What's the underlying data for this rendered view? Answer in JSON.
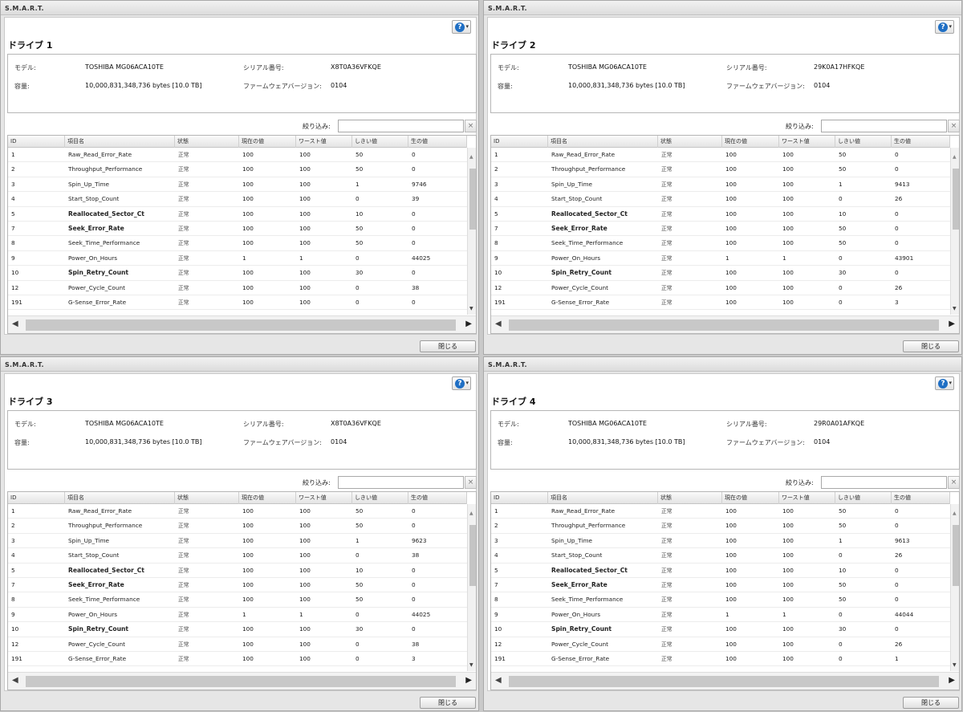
{
  "window_title": "S.M.A.R.T.",
  "labels": {
    "model": "モデル:",
    "serial": "シリアル番号:",
    "capacity": "容量:",
    "firmware": "ファームウェアバージョン:",
    "filter": "絞り込み:",
    "filter_clear": "×",
    "close": "閉じる",
    "help": "?"
  },
  "columns": [
    "ID",
    "項目名",
    "状態",
    "現在の値",
    "ワースト値",
    "しきい値",
    "生の値"
  ],
  "panels": [
    {
      "drive_title": "ドライブ 1",
      "model": "TOSHIBA MG06ACA10TE",
      "serial": "X8T0A36VFKQE",
      "capacity": "10,000,831,348,736 bytes [10.0 TB]",
      "firmware": "0104",
      "filter_value": "",
      "rows": [
        {
          "id": "1",
          "name": "Raw_Read_Error_Rate",
          "status": "正常",
          "current": "100",
          "worst": "100",
          "threshold": "50",
          "raw": "0",
          "bold": false
        },
        {
          "id": "2",
          "name": "Throughput_Performance",
          "status": "正常",
          "current": "100",
          "worst": "100",
          "threshold": "50",
          "raw": "0",
          "bold": false
        },
        {
          "id": "3",
          "name": "Spin_Up_Time",
          "status": "正常",
          "current": "100",
          "worst": "100",
          "threshold": "1",
          "raw": "9746",
          "bold": false
        },
        {
          "id": "4",
          "name": "Start_Stop_Count",
          "status": "正常",
          "current": "100",
          "worst": "100",
          "threshold": "0",
          "raw": "39",
          "bold": false
        },
        {
          "id": "5",
          "name": "Reallocated_Sector_Ct",
          "status": "正常",
          "current": "100",
          "worst": "100",
          "threshold": "10",
          "raw": "0",
          "bold": true
        },
        {
          "id": "7",
          "name": "Seek_Error_Rate",
          "status": "正常",
          "current": "100",
          "worst": "100",
          "threshold": "50",
          "raw": "0",
          "bold": true
        },
        {
          "id": "8",
          "name": "Seek_Time_Performance",
          "status": "正常",
          "current": "100",
          "worst": "100",
          "threshold": "50",
          "raw": "0",
          "bold": false
        },
        {
          "id": "9",
          "name": "Power_On_Hours",
          "status": "正常",
          "current": "1",
          "worst": "1",
          "threshold": "0",
          "raw": "44025",
          "bold": false
        },
        {
          "id": "10",
          "name": "Spin_Retry_Count",
          "status": "正常",
          "current": "100",
          "worst": "100",
          "threshold": "30",
          "raw": "0",
          "bold": true
        },
        {
          "id": "12",
          "name": "Power_Cycle_Count",
          "status": "正常",
          "current": "100",
          "worst": "100",
          "threshold": "0",
          "raw": "38",
          "bold": false
        },
        {
          "id": "191",
          "name": "G-Sense_Error_Rate",
          "status": "正常",
          "current": "100",
          "worst": "100",
          "threshold": "0",
          "raw": "0",
          "bold": false
        }
      ]
    },
    {
      "drive_title": "ドライブ 2",
      "model": "TOSHIBA MG06ACA10TE",
      "serial": "29K0A17HFKQE",
      "capacity": "10,000,831,348,736 bytes [10.0 TB]",
      "firmware": "0104",
      "filter_value": "",
      "rows": [
        {
          "id": "1",
          "name": "Raw_Read_Error_Rate",
          "status": "正常",
          "current": "100",
          "worst": "100",
          "threshold": "50",
          "raw": "0",
          "bold": false
        },
        {
          "id": "2",
          "name": "Throughput_Performance",
          "status": "正常",
          "current": "100",
          "worst": "100",
          "threshold": "50",
          "raw": "0",
          "bold": false
        },
        {
          "id": "3",
          "name": "Spin_Up_Time",
          "status": "正常",
          "current": "100",
          "worst": "100",
          "threshold": "1",
          "raw": "9413",
          "bold": false
        },
        {
          "id": "4",
          "name": "Start_Stop_Count",
          "status": "正常",
          "current": "100",
          "worst": "100",
          "threshold": "0",
          "raw": "26",
          "bold": false
        },
        {
          "id": "5",
          "name": "Reallocated_Sector_Ct",
          "status": "正常",
          "current": "100",
          "worst": "100",
          "threshold": "10",
          "raw": "0",
          "bold": true
        },
        {
          "id": "7",
          "name": "Seek_Error_Rate",
          "status": "正常",
          "current": "100",
          "worst": "100",
          "threshold": "50",
          "raw": "0",
          "bold": true
        },
        {
          "id": "8",
          "name": "Seek_Time_Performance",
          "status": "正常",
          "current": "100",
          "worst": "100",
          "threshold": "50",
          "raw": "0",
          "bold": false
        },
        {
          "id": "9",
          "name": "Power_On_Hours",
          "status": "正常",
          "current": "1",
          "worst": "1",
          "threshold": "0",
          "raw": "43901",
          "bold": false
        },
        {
          "id": "10",
          "name": "Spin_Retry_Count",
          "status": "正常",
          "current": "100",
          "worst": "100",
          "threshold": "30",
          "raw": "0",
          "bold": true
        },
        {
          "id": "12",
          "name": "Power_Cycle_Count",
          "status": "正常",
          "current": "100",
          "worst": "100",
          "threshold": "0",
          "raw": "26",
          "bold": false
        },
        {
          "id": "191",
          "name": "G-Sense_Error_Rate",
          "status": "正常",
          "current": "100",
          "worst": "100",
          "threshold": "0",
          "raw": "3",
          "bold": false
        }
      ]
    },
    {
      "drive_title": "ドライブ 3",
      "model": "TOSHIBA MG06ACA10TE",
      "serial": "X8T0A36VFKQE",
      "capacity": "10,000,831,348,736 bytes [10.0 TB]",
      "firmware": "0104",
      "filter_value": "",
      "rows": [
        {
          "id": "1",
          "name": "Raw_Read_Error_Rate",
          "status": "正常",
          "current": "100",
          "worst": "100",
          "threshold": "50",
          "raw": "0",
          "bold": false
        },
        {
          "id": "2",
          "name": "Throughput_Performance",
          "status": "正常",
          "current": "100",
          "worst": "100",
          "threshold": "50",
          "raw": "0",
          "bold": false
        },
        {
          "id": "3",
          "name": "Spin_Up_Time",
          "status": "正常",
          "current": "100",
          "worst": "100",
          "threshold": "1",
          "raw": "9623",
          "bold": false
        },
        {
          "id": "4",
          "name": "Start_Stop_Count",
          "status": "正常",
          "current": "100",
          "worst": "100",
          "threshold": "0",
          "raw": "38",
          "bold": false
        },
        {
          "id": "5",
          "name": "Reallocated_Sector_Ct",
          "status": "正常",
          "current": "100",
          "worst": "100",
          "threshold": "10",
          "raw": "0",
          "bold": true
        },
        {
          "id": "7",
          "name": "Seek_Error_Rate",
          "status": "正常",
          "current": "100",
          "worst": "100",
          "threshold": "50",
          "raw": "0",
          "bold": true
        },
        {
          "id": "8",
          "name": "Seek_Time_Performance",
          "status": "正常",
          "current": "100",
          "worst": "100",
          "threshold": "50",
          "raw": "0",
          "bold": false
        },
        {
          "id": "9",
          "name": "Power_On_Hours",
          "status": "正常",
          "current": "1",
          "worst": "1",
          "threshold": "0",
          "raw": "44025",
          "bold": false
        },
        {
          "id": "10",
          "name": "Spin_Retry_Count",
          "status": "正常",
          "current": "100",
          "worst": "100",
          "threshold": "30",
          "raw": "0",
          "bold": true
        },
        {
          "id": "12",
          "name": "Power_Cycle_Count",
          "status": "正常",
          "current": "100",
          "worst": "100",
          "threshold": "0",
          "raw": "38",
          "bold": false
        },
        {
          "id": "191",
          "name": "G-Sense_Error_Rate",
          "status": "正常",
          "current": "100",
          "worst": "100",
          "threshold": "0",
          "raw": "3",
          "bold": false
        }
      ]
    },
    {
      "drive_title": "ドライブ 4",
      "model": "TOSHIBA MG06ACA10TE",
      "serial": "29R0A01AFKQE",
      "capacity": "10,000,831,348,736 bytes [10.0 TB]",
      "firmware": "0104",
      "filter_value": "",
      "rows": [
        {
          "id": "1",
          "name": "Raw_Read_Error_Rate",
          "status": "正常",
          "current": "100",
          "worst": "100",
          "threshold": "50",
          "raw": "0",
          "bold": false
        },
        {
          "id": "2",
          "name": "Throughput_Performance",
          "status": "正常",
          "current": "100",
          "worst": "100",
          "threshold": "50",
          "raw": "0",
          "bold": false
        },
        {
          "id": "3",
          "name": "Spin_Up_Time",
          "status": "正常",
          "current": "100",
          "worst": "100",
          "threshold": "1",
          "raw": "9613",
          "bold": false
        },
        {
          "id": "4",
          "name": "Start_Stop_Count",
          "status": "正常",
          "current": "100",
          "worst": "100",
          "threshold": "0",
          "raw": "26",
          "bold": false
        },
        {
          "id": "5",
          "name": "Reallocated_Sector_Ct",
          "status": "正常",
          "current": "100",
          "worst": "100",
          "threshold": "10",
          "raw": "0",
          "bold": true
        },
        {
          "id": "7",
          "name": "Seek_Error_Rate",
          "status": "正常",
          "current": "100",
          "worst": "100",
          "threshold": "50",
          "raw": "0",
          "bold": true
        },
        {
          "id": "8",
          "name": "Seek_Time_Performance",
          "status": "正常",
          "current": "100",
          "worst": "100",
          "threshold": "50",
          "raw": "0",
          "bold": false
        },
        {
          "id": "9",
          "name": "Power_On_Hours",
          "status": "正常",
          "current": "1",
          "worst": "1",
          "threshold": "0",
          "raw": "44044",
          "bold": false
        },
        {
          "id": "10",
          "name": "Spin_Retry_Count",
          "status": "正常",
          "current": "100",
          "worst": "100",
          "threshold": "30",
          "raw": "0",
          "bold": true
        },
        {
          "id": "12",
          "name": "Power_Cycle_Count",
          "status": "正常",
          "current": "100",
          "worst": "100",
          "threshold": "0",
          "raw": "26",
          "bold": false
        },
        {
          "id": "191",
          "name": "G-Sense_Error_Rate",
          "status": "正常",
          "current": "100",
          "worst": "100",
          "threshold": "0",
          "raw": "1",
          "bold": false
        }
      ]
    }
  ]
}
